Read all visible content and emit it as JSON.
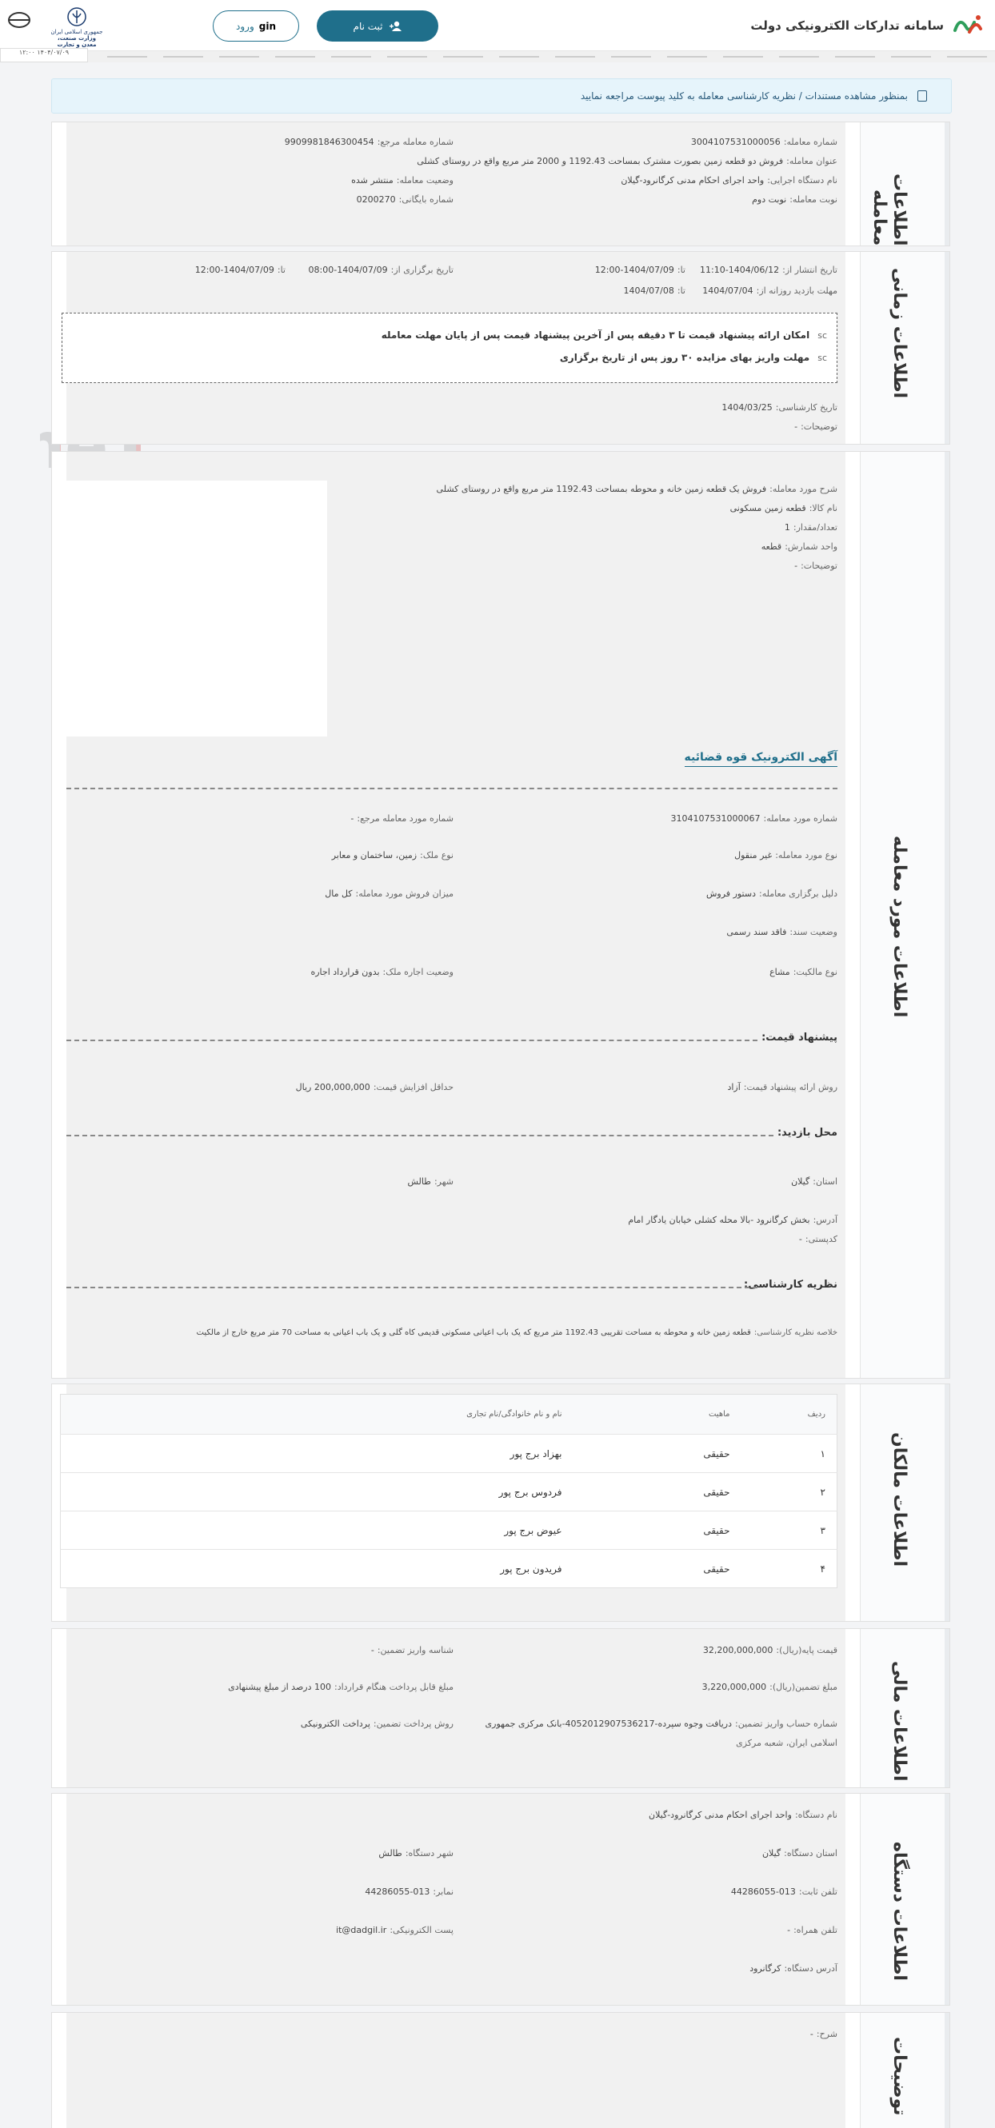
{
  "header": {
    "site_title": "سامانه تدارکات الکترونیکی دولت",
    "register_label": "ثبت نام",
    "login_label": "ورود",
    "login_prefix": "gin",
    "gov_logo_line1": "جمهوری اسلامی ایران",
    "gov_logo_line2": "وزارت صنعت، معدن و تجارت",
    "left_tab": "۱۴۰۴/۰۷/۰۹ ۱۲:۰۰"
  },
  "notice": {
    "text": "بمنظور مشاهده مستندات / نظریه کارشناسی معامله به کلید پیوست مراجعه نمایید"
  },
  "watermark": "AriaTender.neT",
  "deal_info": {
    "title": "اطلاعات معامله",
    "deal_number_label": "شماره معامله:",
    "deal_number": "3004107531000056",
    "ref_number_label": "شماره معامله مرجع:",
    "ref_number": "9909981846300454",
    "subject_label": "عنوان معامله:",
    "subject": "فروش دو قطعه زمین بصورت مشترک بمساحت 1192.43 و 2000 متر مربع واقع در روستای کشلی",
    "status_label": "وضعیت معامله:",
    "status": "منتشر شده",
    "agency_label": "نام دستگاه اجرایی:",
    "agency": "واحد اجرای احکام مدنی کرگانرود-گیلان",
    "archive_label": "شماره بایگانی:",
    "archive": "0200270",
    "turn_label": "نوبت معامله:",
    "turn": "نوبت دوم"
  },
  "time_info": {
    "title": "اطلاعات زمانی",
    "publish_label": "تاریخ انتشار از:",
    "publish_from": "1404/06/12-11:10",
    "to_label": "تا:",
    "publish_to": "1404/07/09-12:00",
    "hold_label": "تاریخ برگزاری از:",
    "hold_from": "1404/07/09-08:00",
    "hold_to": "1404/07/09-12:00",
    "visit_label": "مهلت بازدید روزانه از:",
    "visit_from": "1404/07/04",
    "visit_to": "1404/07/08",
    "rule1": "امکان ارائه پیشنهاد قیمت تا ۳ دقیقه پس از آخرین پیشنهاد قیمت پس از پایان مهلت معامله",
    "rule2": "مهلت واریز بهای مزایده ۳۰ روز پس از تاریخ برگزاری",
    "rule_tag": "sc",
    "expert_date_label": "تاریخ کارشناسی:",
    "expert_date": "1404/03/25",
    "desc_label": "توضیحات:",
    "desc": "-"
  },
  "item_info": {
    "title": "اطلاعات مورد معامله",
    "item_desc_label": "شرح مورد معامله:",
    "item_desc": "فروش یک قطعه زمین خانه و محوطه بمساحت 1192.43 متر مربع واقع در روستای کشلی",
    "goods_name_label": "نام کالا:",
    "goods_name": "قطعه زمین مسکونی",
    "qty_label": "تعداد/مقدار:",
    "qty": "1",
    "unit_label": "واحد شمارش:",
    "unit": "قطعه",
    "desc_label": "توضیحات:",
    "desc": "-",
    "link_title": "آگهی الکترونیک قوه قضائیه",
    "item_number_label": "شماره مورد معامله:",
    "item_number": "3104107531000067",
    "item_ref_label": "شماره مورد معامله مرجع:",
    "item_ref": "-",
    "item_type_label": "نوع مورد معامله:",
    "item_type": "غیر منقول",
    "property_type_label": "نوع ملک:",
    "property_type": "زمین، ساختمان و معابر",
    "reason_label": "دلیل برگزاری معامله:",
    "reason": "دستور فروش",
    "sale_amount_label": "میزان فروش مورد معامله:",
    "sale_amount": "کل مال",
    "doc_status_label": "وضعیت سند:",
    "doc_status": "فاقد سند رسمی",
    "ownership_label": "نوع مالکیت:",
    "ownership": "مشاع",
    "lease_label": "وضعیت اجاره ملک:",
    "lease": "بدون قرارداد اجاره",
    "price_head": "پیشنهاد قیمت:",
    "price_method_label": "روش ارائه پیشنهاد قیمت:",
    "price_method": "آزاد",
    "min_increase_label": "حداقل افزایش قیمت:",
    "min_increase": "200,000,000 ریال",
    "visit_head": "محل بازدید:",
    "province_label": "استان:",
    "province": "گیلان",
    "city_label": "شهر:",
    "city": "طالش",
    "address_label": "آدرس:",
    "address": "بخش کرگانرود -بالا محله کشلی خیابان یادگار امام",
    "postal_label": "کدپستی:",
    "postal": "-",
    "expert_head": "نظریه کارشناسی:",
    "expert_summary_label": "خلاصه نظریه کارشناسی:",
    "expert_summary": "قطعه زمین خانه و محوطه به مساحت تقریبی 1192.43 متر مربع که یک باب اعیانی مسکونی قدیمی کاه گلی و یک باب اعیانی به مساحت 70 متر مربع خارج از مالکیت"
  },
  "owners": {
    "title": "اطلاعات مالکان",
    "headers": [
      "ردیف",
      "ماهیت",
      "نام و نام خانوادگی/نام تجاری"
    ],
    "rows": [
      {
        "n": "۱",
        "type": "حقیقی",
        "name": "بهزاد برج پور"
      },
      {
        "n": "۲",
        "type": "حقیقی",
        "name": "فردوس برج پور"
      },
      {
        "n": "۳",
        "type": "حقیقی",
        "name": "عیوض برج پور"
      },
      {
        "n": "۴",
        "type": "حقیقی",
        "name": "فریدون برج پور"
      }
    ]
  },
  "finance": {
    "title": "اطلاعات مالی",
    "base_price_label": "قیمت پایه(ریال):",
    "base_price": "32,200,000,000",
    "guarantee_id_label": "شناسه واریز تضمین:",
    "guarantee_id": "-",
    "guarantee_amount_label": "مبلغ تضمین(ریال):",
    "guarantee_amount": "3,220,000,000",
    "payable_label": "مبلغ قابل پرداخت هنگام قرارداد:",
    "payable": "100 درصد از مبلغ پیشنهادی",
    "account_label": "شماره حساب واریز تضمین:",
    "account": "دریافت وجوه سپرده-4052012907536217-بانک مرکزی جمهوری",
    "account_line2": "اسلامی ایران، شعبه مرکزی",
    "pay_method_label": "روش پرداخت تضمین:",
    "pay_method": "پرداخت الکترونیکی"
  },
  "agency": {
    "title": "اطلاعات دستگاه",
    "name_label": "نام دستگاه:",
    "name": "واحد اجرای احکام مدنی کرگانرود-گیلان",
    "province_label": "استان دستگاه:",
    "province": "گیلان",
    "city_label": "شهر دستگاه:",
    "city": "طالش",
    "phone_label": "تلفن ثابت:",
    "phone": "013-44286055",
    "fax_label": "نمابر:",
    "fax": "013-44286055",
    "mobile_label": "تلفن همراه:",
    "mobile": "-",
    "email_label": "پست الکترونیکی:",
    "email": "it@dadgil.ir",
    "address_label": "آدرس دستگاه:",
    "address": "کرگانرود"
  },
  "notes": {
    "title": "توضیحات",
    "desc_label": "شرح:",
    "desc": "-"
  }
}
